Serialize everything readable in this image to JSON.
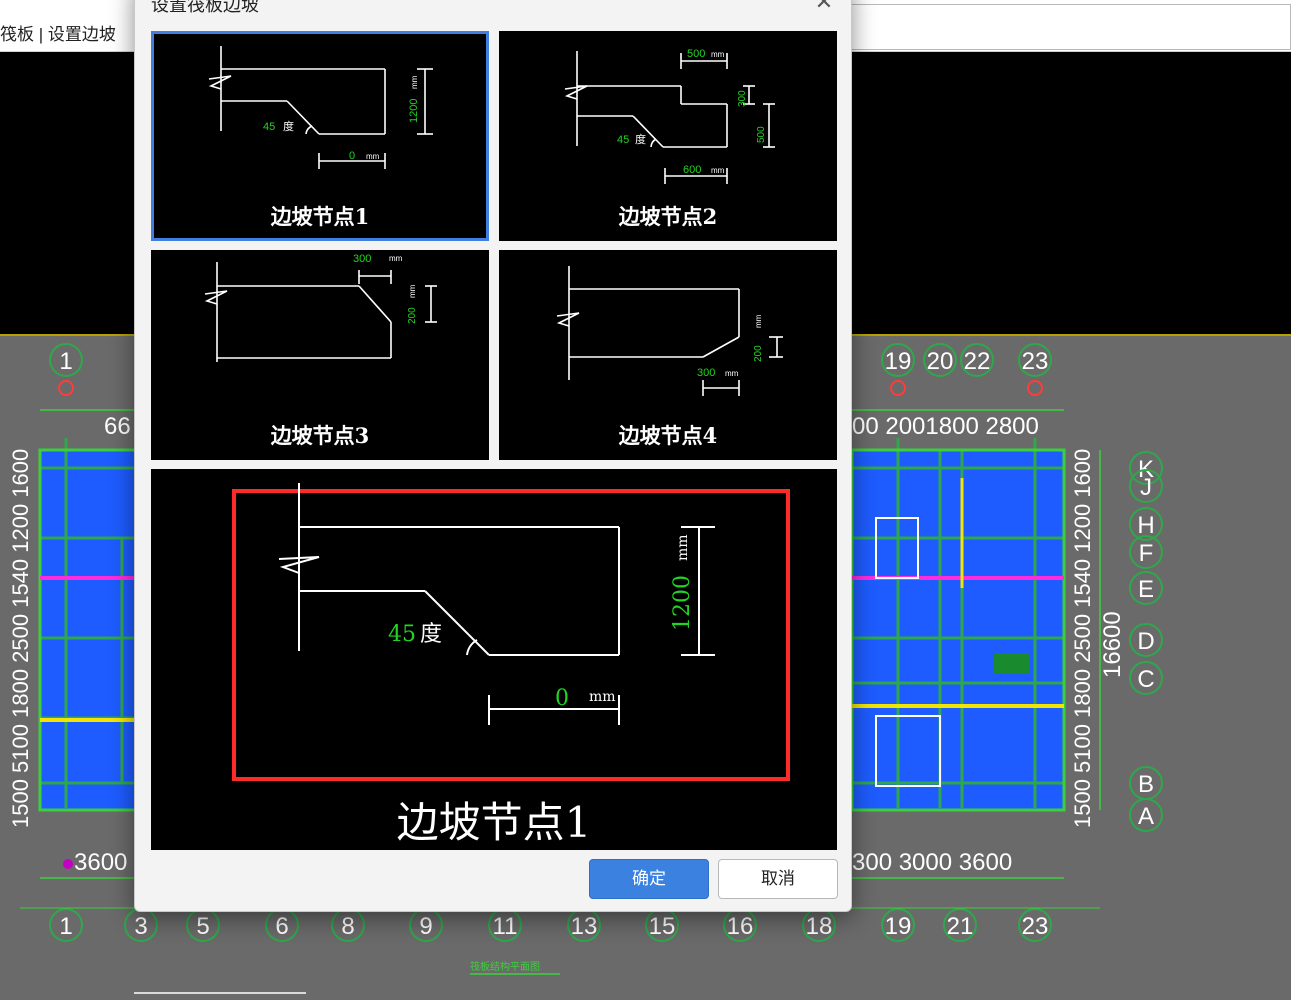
{
  "app": {
    "breadcrumb": "筏板 | 设置边坡"
  },
  "dialog": {
    "title": "设置筏板边坡",
    "close_icon": "close-icon",
    "nodes": [
      {
        "caption": "边坡节点1",
        "selected": true,
        "labels": {
          "angle": "45",
          "angle_unit": "度",
          "height": "1200",
          "width": "0",
          "unit": "mm"
        }
      },
      {
        "caption": "边坡节点2",
        "selected": false,
        "labels": {
          "top": "500",
          "right_top": "300",
          "right_bottom": "500",
          "angle": "45",
          "angle_unit": "度",
          "bottom": "600",
          "unit": "mm"
        }
      },
      {
        "caption": "边坡节点3",
        "selected": false,
        "labels": {
          "width": "300",
          "height": "200",
          "unit": "mm"
        }
      },
      {
        "caption": "边坡节点4",
        "selected": false,
        "labels": {
          "width": "300",
          "height": "200",
          "unit": "mm"
        }
      }
    ],
    "preview": {
      "caption": "边坡节点1",
      "angle": "45",
      "angle_unit": "度",
      "height": "1200",
      "width": "0",
      "unit": "mm"
    },
    "ok_label": "确定",
    "cancel_label": "取消"
  },
  "cad": {
    "axis_top_left": [
      "1"
    ],
    "axis_top_right": [
      "19",
      "20",
      "22",
      "23"
    ],
    "dim_top_left": "66",
    "dim_top_right": "00  2001800 2800",
    "axis_right": [
      "K",
      "J",
      "H",
      "F",
      "E",
      "D",
      "C",
      "B",
      "A"
    ],
    "dim_right_vertical": "16600",
    "dim_right_labels": "1500  5100  1800 2500 1540 1200 1600",
    "dim_left_labels": "1500  5100  1800 2500 1540 1200 1600",
    "dim_bottom_left": "3600",
    "dim_bottom_right": "300  3000  3600",
    "axis_bottom": [
      "1",
      "3",
      "5",
      "6",
      "8",
      "9",
      "11",
      "13",
      "15",
      "16",
      "18",
      "19",
      "21",
      "23"
    ],
    "drawing_title": "筏板结构平面图",
    "colors": {
      "slab": "#1e5cff",
      "beam": "#2ea84a",
      "grid": "#3ccf3c",
      "axis_bubble": "#2ea84a",
      "marker": "#ff3b3b"
    }
  }
}
